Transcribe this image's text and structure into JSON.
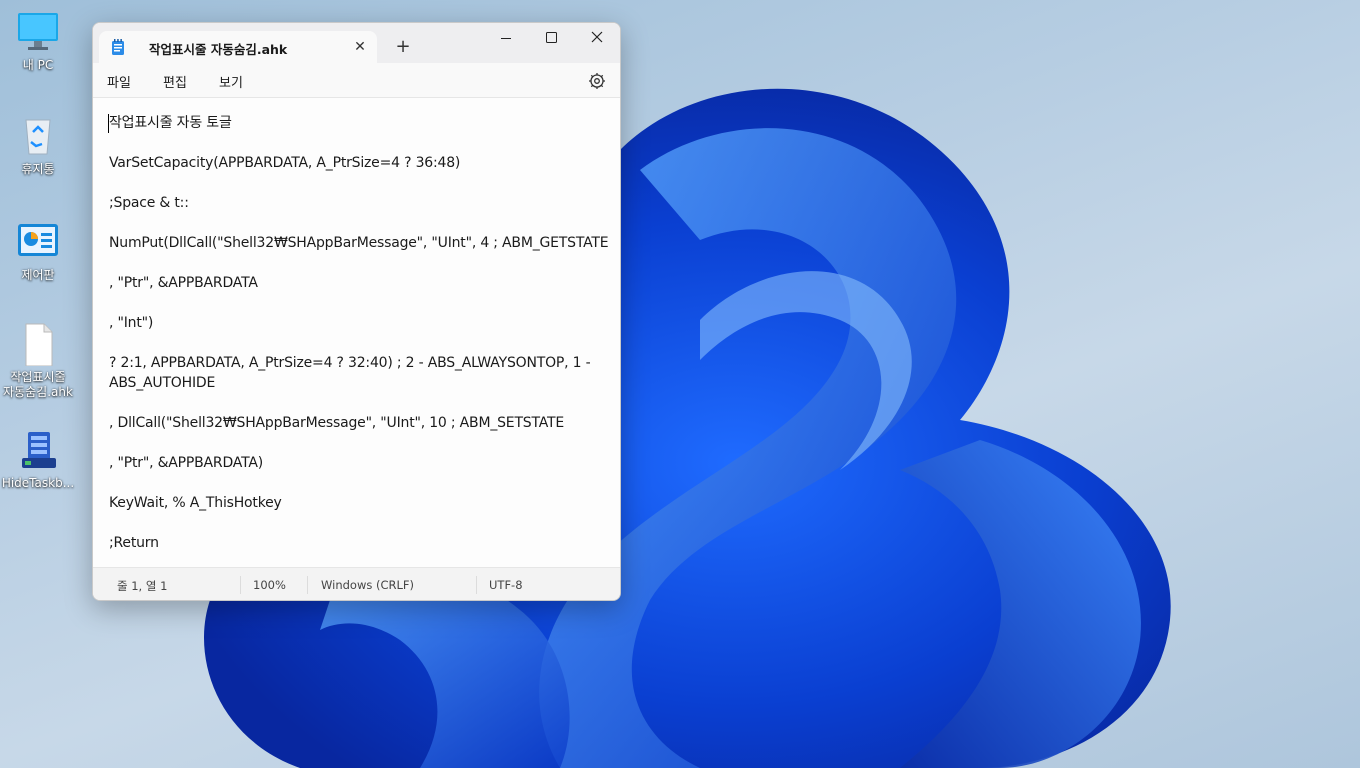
{
  "desktop": {
    "icons": [
      {
        "label": "내 PC",
        "icon": "monitor-icon"
      },
      {
        "label": "휴지통",
        "icon": "recycle-bin-icon"
      },
      {
        "label": "제어판",
        "icon": "control-panel-icon"
      },
      {
        "label": "작업표시줄\n자동숨김.ahk",
        "icon": "file-icon"
      },
      {
        "label": "HideTaskb...",
        "icon": "app-icon"
      }
    ]
  },
  "window": {
    "tab_title": "작업표시줄 자동숨김.ahk",
    "close_tab": "✕",
    "new_tab": "+",
    "minimize": "—",
    "maximize": "☐",
    "close": "✕",
    "menu": [
      "파일",
      "편집",
      "보기"
    ],
    "settings_icon": "gear-icon"
  },
  "editor": {
    "lines": [
      "작업표시줄 자동 토글",
      "VarSetCapacity(APPBARDATA, A_PtrSize=4 ? 36:48)",
      ";Space & t::",
      "NumPut(DllCall(\"Shell32₩SHAppBarMessage\", \"UInt\", 4 ; ABM_GETSTATE",
      ", \"Ptr\", &APPBARDATA",
      ", \"Int\")",
      "? 2:1, APPBARDATA, A_PtrSize=4 ? 32:40) ; 2 - ABS_ALWAYSONTOP, 1 - ABS_AUTOHIDE",
      ", DllCall(\"Shell32₩SHAppBarMessage\", \"UInt\", 10 ; ABM_SETSTATE",
      ", \"Ptr\", &APPBARDATA)",
      "KeyWait, % A_ThisHotkey",
      ";Return"
    ]
  },
  "status": {
    "position": "줄 1, 열 1",
    "zoom": "100%",
    "line_ending": "Windows (CRLF)",
    "encoding": "UTF-8"
  }
}
